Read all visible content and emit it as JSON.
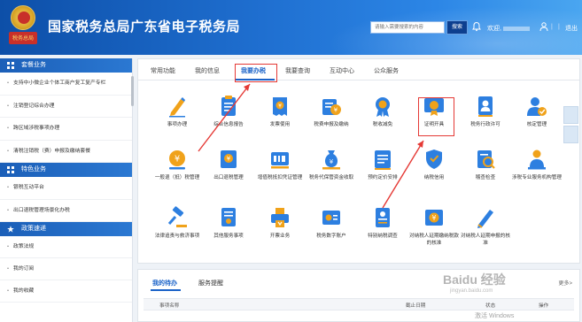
{
  "header": {
    "emblem_text": "税务总局",
    "site_title": "国家税务总局广东省电子税务局",
    "search_placeholder": "请输入需要搜索的内容",
    "search_button": "搜索",
    "welcome_prefix": "欢迎,",
    "logout": "退出",
    "icons": [
      "notification-icon",
      "user-icon"
    ]
  },
  "sidebar": {
    "sections": [
      {
        "title": "套餐业务",
        "icon": "grid-icon",
        "items": [
          "支持中小微企业个体工商户复工复产专栏",
          "注销登记综合办理",
          "跨区域涉税事项办理",
          "清税注销税（费）申报及缴纳套餐"
        ]
      },
      {
        "title": "特色业务",
        "icon": "grid-icon",
        "items": [
          "银税互动平台",
          "出口退税管理场景化办税"
        ]
      },
      {
        "title": "政策速递",
        "icon": "star-icon",
        "items": [
          "政策法规",
          "我的订阅",
          "我的收藏"
        ]
      }
    ]
  },
  "main": {
    "tabs": [
      "常用功能",
      "我的信息",
      "我要办税",
      "我要查询",
      "互动中心",
      "公众服务"
    ],
    "active_tab": 2,
    "tiles": [
      {
        "label": "事项办理",
        "icon": "pen-icon"
      },
      {
        "label": "综合信息报告",
        "icon": "clipboard-icon"
      },
      {
        "label": "发票使用",
        "icon": "invoice-icon"
      },
      {
        "label": "税费申报及缴纳",
        "icon": "tax-declare-icon"
      },
      {
        "label": "税收减免",
        "icon": "medal-icon"
      },
      {
        "label": "证明开具",
        "icon": "certificate-icon"
      },
      {
        "label": "税务行政许可",
        "icon": "badge-icon"
      },
      {
        "label": "核定管理",
        "icon": "person-check-icon"
      },
      {
        "label": "一般退（抵）税管理",
        "icon": "refund-icon"
      },
      {
        "label": "出口退税管理",
        "icon": "export-refund-icon"
      },
      {
        "label": "增值税抵扣凭证管理",
        "icon": "voucher-icon"
      },
      {
        "label": "税务代保管资金收取",
        "icon": "moneybag-icon"
      },
      {
        "label": "预约定价安排",
        "icon": "calendar-doc-icon"
      },
      {
        "label": "纳税信用",
        "icon": "shield-icon"
      },
      {
        "label": "稽查检查",
        "icon": "search-doc-icon"
      },
      {
        "label": "涉税专业服务机构管理",
        "icon": "team-icon"
      },
      {
        "label": "法律追责与救济事项",
        "icon": "gavel-icon"
      },
      {
        "label": "其他服务事项",
        "icon": "service-doc-icon"
      },
      {
        "label": "开票业务",
        "icon": "print-icon"
      },
      {
        "label": "税务数字账户",
        "icon": "account-icon"
      },
      {
        "label": "特别纳税调查",
        "icon": "report-icon"
      },
      {
        "label": "对纳税人延期缴纳税款的核准",
        "icon": "delay-pay-icon"
      },
      {
        "label": "对纳税人延期申报的核准",
        "icon": "delay-declare-icon"
      }
    ]
  },
  "lower": {
    "tabs": [
      "我的待办",
      "服务提醒"
    ],
    "more": "更多>",
    "columns": [
      "事项名称",
      "截止日期",
      "状态",
      "操作"
    ]
  },
  "overlay": {
    "watermark": "Baidu 经验",
    "watermark_url": "jingyan.baidu.com",
    "windows": "激活 Windows"
  },
  "colors": {
    "header_blue": "#1f6fd0",
    "tile_blue": "#2d7fe0",
    "tile_gold": "#f0a21a",
    "annotation_red": "#e53935"
  }
}
